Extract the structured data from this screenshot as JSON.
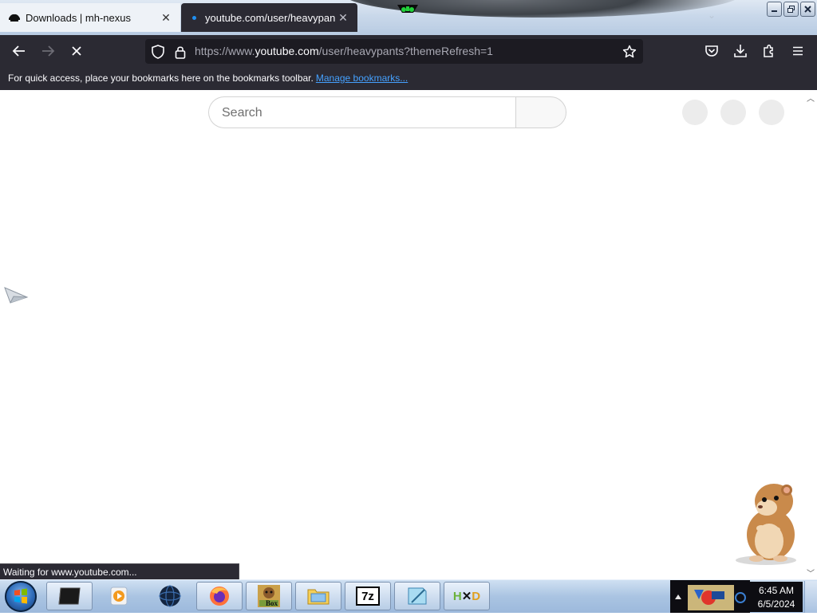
{
  "browser": {
    "tabs": [
      {
        "title": "Downloads | mh-nexus",
        "active": false
      },
      {
        "title": "youtube.com/user/heavypants",
        "active": true
      }
    ],
    "url": {
      "prefix": "https://www.",
      "domain": "youtube.com",
      "path": "/user/heavypants?themeRefresh=1"
    },
    "bookmarks": {
      "message": "For quick access, place your bookmarks here on the bookmarks toolbar.",
      "link": "Manage bookmarks..."
    },
    "status": "Waiting for www.youtube.com..."
  },
  "page": {
    "search": {
      "placeholder": "Search"
    }
  },
  "taskbar": {
    "time": "6:45 AM",
    "date": "6/5/2024",
    "apps": [
      {
        "name": "terminal",
        "label": ""
      },
      {
        "name": "media-player",
        "label": ""
      },
      {
        "name": "globe",
        "label": ""
      },
      {
        "name": "firefox",
        "label": ""
      },
      {
        "name": "sandboxie",
        "label": "Box"
      },
      {
        "name": "file-explorer",
        "label": ""
      },
      {
        "name": "7zip",
        "label": "7z"
      },
      {
        "name": "notepad",
        "label": ""
      },
      {
        "name": "hxd",
        "label": "HxD"
      }
    ]
  },
  "colors": {
    "toolbar_bg": "#2b2a33",
    "urlbar_bg": "#1c1b22",
    "link": "#45a1ff",
    "loading": "#1f8ff0"
  }
}
